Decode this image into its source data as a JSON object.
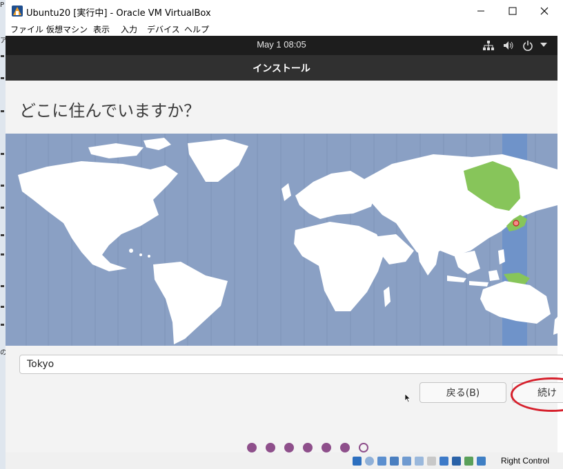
{
  "window": {
    "title": "Ubuntu20 [実行中] - Oracle VM VirtualBox",
    "controls": {
      "minimize": "—",
      "maximize": "☐",
      "close": "✕"
    }
  },
  "menu": [
    "ファイル",
    "仮想マシン",
    "表示",
    "入力",
    "デバイス",
    "ヘルプ"
  ],
  "ubuntu_bar": {
    "clock": "May 1  08:05",
    "icons": [
      "network-icon",
      "volume-icon",
      "power-icon",
      "dropdown-icon"
    ]
  },
  "installer": {
    "header": "インストール",
    "question": "どこに住んでいますか？",
    "location_value": "Tokyo",
    "back_label": "戻る(B)",
    "continue_label": "続け",
    "selected_timezone": "Asia/Tokyo",
    "progress": {
      "total": 7,
      "completed": 6
    }
  },
  "statusbar": {
    "host_key": "Right Control"
  },
  "desktop_strip": [
    "P",
    "ア",
    "の"
  ],
  "colors": {
    "ocean": "#8aa0c4",
    "land": "#ffffff",
    "tz_band": "#6f93c9",
    "highlight_region": "#87c55a",
    "accent": "#8e4f8b",
    "annotation": "#d6202c"
  }
}
